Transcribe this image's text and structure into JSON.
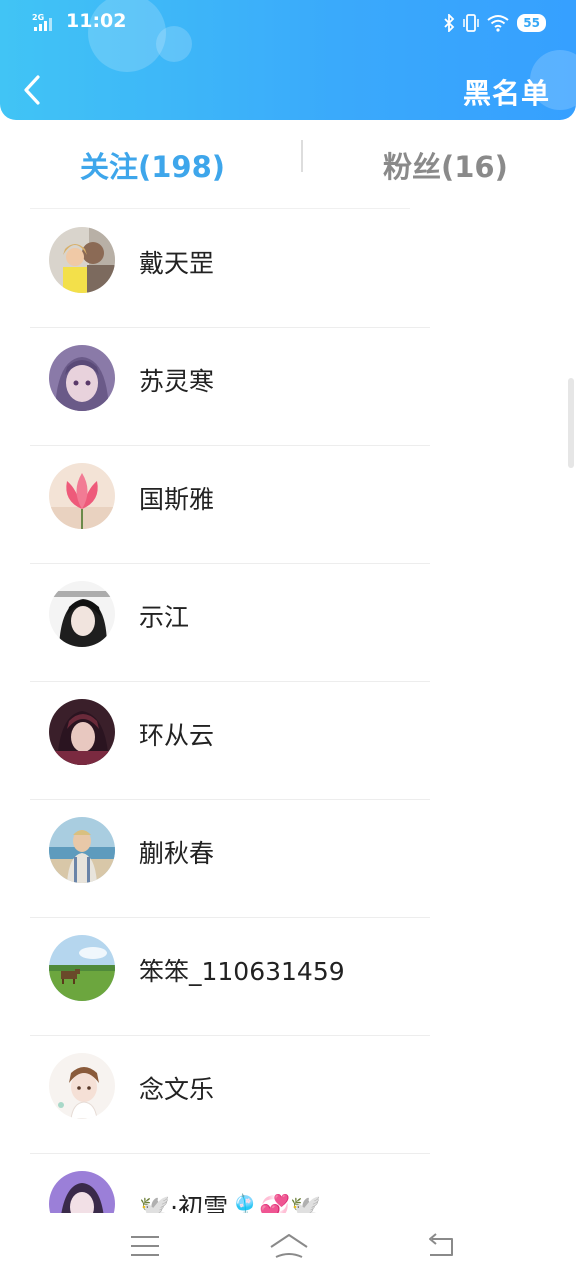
{
  "status_bar": {
    "network": "2G",
    "time": "11:02",
    "battery": "55"
  },
  "header": {
    "back_icon": "chevron-left-icon",
    "blacklist_label": "黑名单"
  },
  "tabs": [
    {
      "label": "关注(198)",
      "active": true
    },
    {
      "label": "粉丝(16)",
      "active": false
    }
  ],
  "follow_list": [
    {
      "name": "戴天罡",
      "avatar": "avatar-family-photo"
    },
    {
      "name": "苏灵寒",
      "avatar": "avatar-anime-girl"
    },
    {
      "name": "国斯雅",
      "avatar": "avatar-lotus-flower"
    },
    {
      "name": "示江",
      "avatar": "avatar-anime-boy-dark"
    },
    {
      "name": "环从云",
      "avatar": "avatar-anime-boy-red"
    },
    {
      "name": "蒯秋春",
      "avatar": "avatar-beach-boy"
    },
    {
      "name": "笨笨_110631459",
      "avatar": "avatar-landscape-cow"
    },
    {
      "name": "念文乐",
      "avatar": "avatar-cartoon-boy"
    },
    {
      "name": "🕊️·初雪🎐💞🕊️",
      "avatar": "avatar-girl-purple"
    }
  ],
  "nav_bar": {
    "menu_icon": "menu-icon",
    "home_icon": "home-icon",
    "back_icon": "back-icon"
  },
  "colors": {
    "header_start": "#41c4f5",
    "header_end": "#36a0ff",
    "active_tab": "#3ea6eb",
    "inactive_tab": "#8a8a8a"
  }
}
